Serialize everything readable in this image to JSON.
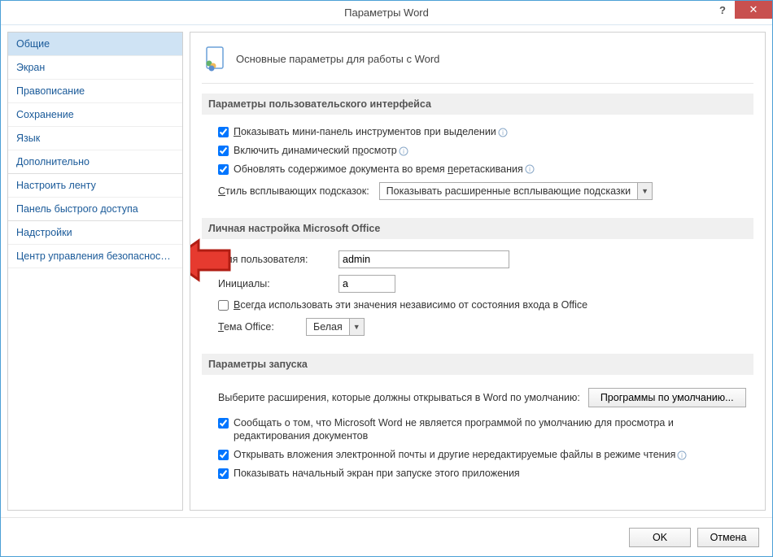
{
  "window": {
    "title": "Параметры Word",
    "help": "?",
    "close": "✕"
  },
  "nav": {
    "items": [
      "Общие",
      "Экран",
      "Правописание",
      "Сохранение",
      "Язык",
      "Дополнительно",
      "Настроить ленту",
      "Панель быстрого доступа",
      "Надстройки",
      "Центр управления безопасностью"
    ],
    "selected_index": 0
  },
  "page": {
    "title": "Основные параметры для работы с Word"
  },
  "section_ui": {
    "title": "Параметры пользовательского интерфейса",
    "opts": [
      {
        "checked": true,
        "pre": "",
        "ul": "П",
        "post": "оказывать мини-панель инструментов при выделении",
        "info": true
      },
      {
        "checked": true,
        "pre": "Включить динамический п",
        "ul": "р",
        "post": "осмотр",
        "info": true
      },
      {
        "checked": true,
        "pre": "Обновлять содержимое документа во время ",
        "ul": "п",
        "post": "еретаскивания",
        "info": true
      }
    ],
    "tooltip_label_pre": "",
    "tooltip_label_ul": "С",
    "tooltip_label_post": "тиль всплывающих подсказок:",
    "tooltip_value": "Показывать расширенные всплывающие подсказки"
  },
  "section_personal": {
    "title": "Личная настройка Microsoft Office",
    "username_label_pre": "",
    "username_label_ul": "И",
    "username_label_post": "мя пользователя:",
    "username_value": "admin",
    "initials_label": "Инициалы:",
    "initials_value": "a",
    "always_opt": {
      "checked": false,
      "pre": "",
      "ul": "В",
      "post": "сегда использовать эти значения независимо от состояния входа в Office"
    },
    "theme_label_pre": "",
    "theme_label_ul": "Т",
    "theme_label_post": "ема Office:",
    "theme_value": "Белая"
  },
  "section_startup": {
    "title": "Параметры запуска",
    "ext_label": "Выберите расширения, которые должны открываться в Word по умолчанию:",
    "ext_button": "Программы по умолчанию...",
    "opts": [
      {
        "checked": true,
        "text": "Сообщать о том, что Microsoft Word не является программой по умолчанию для просмотра и редактирования документов",
        "info": false
      },
      {
        "checked": true,
        "text": "Открывать вложения электронной почты и другие нередактируемые файлы в режиме чтения",
        "info": true
      },
      {
        "checked": true,
        "text": "Показывать начальный экран при запуске этого приложения",
        "info": false
      }
    ]
  },
  "footer": {
    "ok": "OK",
    "cancel": "Отмена"
  }
}
